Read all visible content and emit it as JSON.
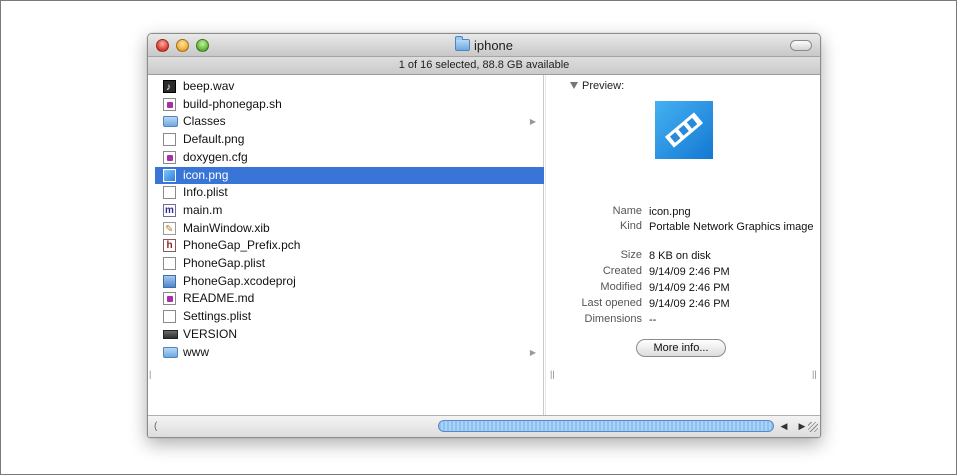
{
  "window": {
    "title": "iphone",
    "status": "1 of 16 selected, 88.8 GB available"
  },
  "files": [
    {
      "name": "beep.wav",
      "icon": "audio-file-icon",
      "selected": false,
      "has_arrow": false
    },
    {
      "name": "build-phonegap.sh",
      "icon": "script-file-icon",
      "selected": false,
      "has_arrow": false
    },
    {
      "name": "Classes",
      "icon": "folder-icon",
      "selected": false,
      "has_arrow": true
    },
    {
      "name": "Default.png",
      "icon": "document-icon",
      "selected": false,
      "has_arrow": false
    },
    {
      "name": "doxygen.cfg",
      "icon": "script-file-icon",
      "selected": false,
      "has_arrow": false
    },
    {
      "name": "icon.png",
      "icon": "image-file-icon",
      "selected": true,
      "has_arrow": false
    },
    {
      "name": "Info.plist",
      "icon": "document-icon",
      "selected": false,
      "has_arrow": false
    },
    {
      "name": "main.m",
      "icon": "objc-m-file-icon",
      "selected": false,
      "has_arrow": false
    },
    {
      "name": "MainWindow.xib",
      "icon": "xib-file-icon",
      "selected": false,
      "has_arrow": false
    },
    {
      "name": "PhoneGap_Prefix.pch",
      "icon": "header-h-file-icon",
      "selected": false,
      "has_arrow": false
    },
    {
      "name": "PhoneGap.plist",
      "icon": "document-icon",
      "selected": false,
      "has_arrow": false
    },
    {
      "name": "PhoneGap.xcodeproj",
      "icon": "xcodeproj-icon",
      "selected": false,
      "has_arrow": false
    },
    {
      "name": "README.md",
      "icon": "script-file-icon",
      "selected": false,
      "has_arrow": false
    },
    {
      "name": "Settings.plist",
      "icon": "document-icon",
      "selected": false,
      "has_arrow": false
    },
    {
      "name": "VERSION",
      "icon": "generic-file-icon",
      "selected": false,
      "has_arrow": false
    },
    {
      "name": "www",
      "icon": "folder-icon",
      "selected": false,
      "has_arrow": true
    }
  ],
  "preview": {
    "header": "Preview:",
    "meta": [
      {
        "key": "Name",
        "value": "icon.png"
      },
      {
        "key": "Kind",
        "value": "Portable Network Graphics image"
      },
      {
        "key": "Size",
        "value": "8 KB on disk"
      },
      {
        "key": "Created",
        "value": "9/14/09 2:46 PM"
      },
      {
        "key": "Modified",
        "value": "9/14/09 2:46 PM"
      },
      {
        "key": "Last opened",
        "value": "9/14/09 2:46 PM"
      },
      {
        "key": "Dimensions",
        "value": "--"
      }
    ],
    "more_info_label": "More info..."
  },
  "colors": {
    "selection": "#3875d7",
    "preview_icon": "#1f8fe6"
  }
}
